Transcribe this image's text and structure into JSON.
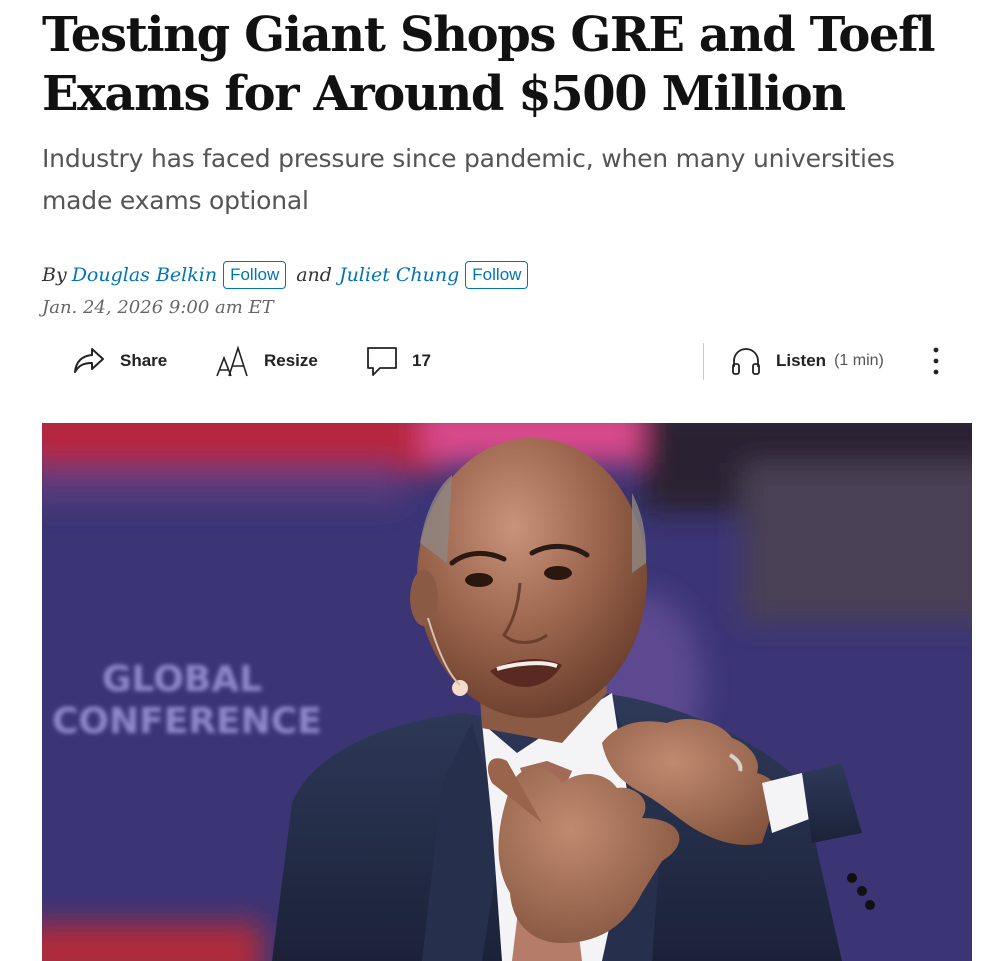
{
  "article": {
    "headline": "Testing Giant Shops GRE and Toefl Exams for Around $500 Million",
    "dek": "Industry has faced pressure since pandemic, when many universities made exams optional",
    "byline": {
      "by": "By",
      "authors": [
        {
          "name": "Douglas Belkin",
          "follow_label": "Follow"
        },
        {
          "name": "Juliet Chung",
          "follow_label": "Follow"
        }
      ],
      "conjunction": "and"
    },
    "timestamp": "Jan. 24, 2026 9:00 am ET"
  },
  "toolbar": {
    "share_label": "Share",
    "share_icon": "share-arrow-icon",
    "resize_label": "Resize",
    "resize_icon": "text-resize-icon",
    "comments_count": "17",
    "comments_icon": "comment-bubble-icon",
    "listen_label": "Listen",
    "listen_duration": "(1 min)",
    "listen_icon": "headphones-icon",
    "more_icon": "vertical-ellipsis-icon"
  },
  "hero_image": {
    "background_sign_text": "GLOBAL CONFERENCE"
  },
  "colors": {
    "link": "#0274b6",
    "headline": "#111111",
    "dek": "#555555",
    "stage_purple": "#3b3576",
    "stage_red": "#b8283c"
  }
}
